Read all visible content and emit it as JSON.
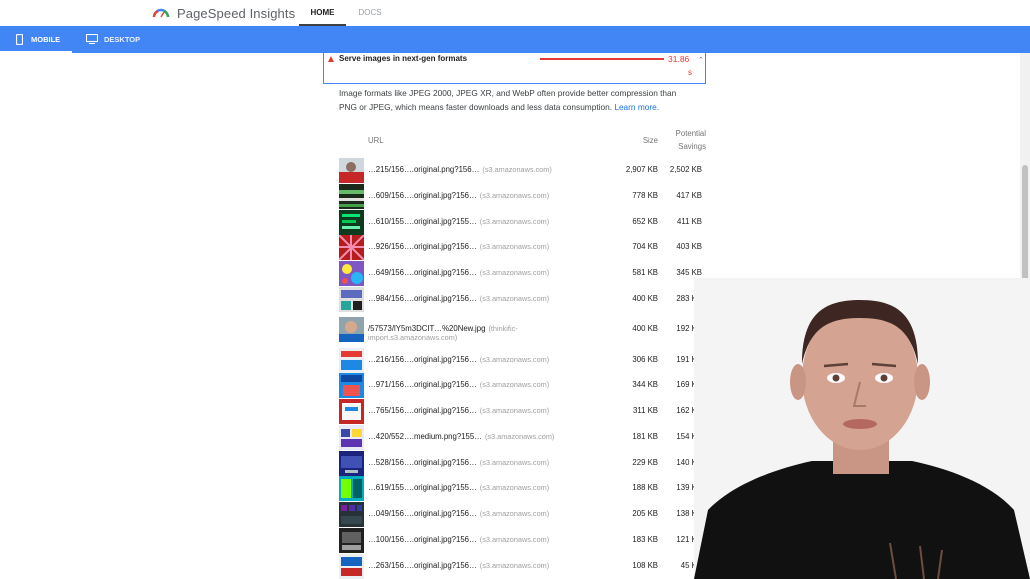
{
  "header": {
    "app_title": "PageSpeed Insights",
    "nav": [
      {
        "label": "HOME"
      },
      {
        "label": "DOCS"
      }
    ]
  },
  "device_tabs": {
    "mobile": "MOBILE",
    "desktop": "DESKTOP"
  },
  "audit": {
    "title": "Serve images in next-gen formats",
    "savings_value": "31.86",
    "savings_unit": "s",
    "description": "Image formats like JPEG 2000, JPEG XR, and WebP often provide better compression than PNG or JPEG, which means faster downloads and less data consumption.",
    "learn_more": "Learn more."
  },
  "table": {
    "headers": {
      "url": "URL",
      "size": "Size",
      "savings": "Potential Savings"
    },
    "rows": [
      {
        "url": "…215/156….original.png?156…",
        "host": "(s3.amazonaws.com)",
        "size": "2,907 KB",
        "savings": "2,502 KB"
      },
      {
        "url": "…609/156….original.jpg?156…",
        "host": "(s3.amazonaws.com)",
        "size": "778 KB",
        "savings": "417 KB"
      },
      {
        "url": "…610/155….original.jpg?155…",
        "host": "(s3.amazonaws.com)",
        "size": "652 KB",
        "savings": "411 KB"
      },
      {
        "url": "…926/156….original.jpg?156…",
        "host": "(s3.amazonaws.com)",
        "size": "704 KB",
        "savings": "403 KB"
      },
      {
        "url": "…649/156….original.jpg?156…",
        "host": "(s3.amazonaws.com)",
        "size": "581 KB",
        "savings": "345 KB"
      },
      {
        "url": "…984/156….original.jpg?156…",
        "host": "(s3.amazonaws.com)",
        "size": "400 KB",
        "savings": "283 KB"
      },
      {
        "url": "/57573/lY5m3DCIT…%20New.jpg",
        "host": "(thinkific-",
        "host2": "import.s3.amazonaws.com)",
        "size": "400 KB",
        "savings": "192 KB"
      },
      {
        "url": "…216/156….original.jpg?156…",
        "host": "(s3.amazonaws.com)",
        "size": "306 KB",
        "savings": "191 KB"
      },
      {
        "url": "…971/156….original.jpg?156…",
        "host": "(s3.amazonaws.com)",
        "size": "344 KB",
        "savings": "169 KB"
      },
      {
        "url": "…765/156….original.jpg?156…",
        "host": "(s3.amazonaws.com)",
        "size": "311 KB",
        "savings": "162 KB"
      },
      {
        "url": "…420/552….medium.png?155…",
        "host": "(s3.amazonaws.com)",
        "size": "181 KB",
        "savings": "154 KB"
      },
      {
        "url": "…528/156….original.jpg?156…",
        "host": "(s3.amazonaws.com)",
        "size": "229 KB",
        "savings": "140 KB"
      },
      {
        "url": "…619/155….original.jpg?155…",
        "host": "(s3.amazonaws.com)",
        "size": "188 KB",
        "savings": "139 KB"
      },
      {
        "url": "…049/156….original.jpg?156…",
        "host": "(s3.amazonaws.com)",
        "size": "205 KB",
        "savings": "138 KB"
      },
      {
        "url": "…100/156….original.jpg?156…",
        "host": "(s3.amazonaws.com)",
        "size": "183 KB",
        "savings": "121 KB"
      },
      {
        "url": "…263/156….original.jpg?156…",
        "host": "(s3.amazonaws.com)",
        "size": "108 KB",
        "savings": "45 KB"
      }
    ]
  },
  "colors": {
    "brand_blue": "#4285f4",
    "fail_red": "#e53935",
    "link": "#1a73e8"
  },
  "icons": [
    "pagespeed-logo-icon",
    "mobile-phone-icon",
    "desktop-monitor-icon",
    "warning-triangle-icon",
    "chevron-up-icon"
  ]
}
